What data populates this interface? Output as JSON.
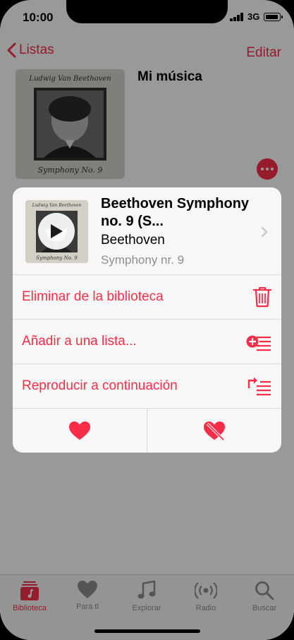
{
  "status": {
    "time": "10:00",
    "network": "3G"
  },
  "nav": {
    "back_label": "Listas",
    "edit_label": "Editar"
  },
  "background": {
    "playlist_title": "Mi música",
    "art_text_top": "Ludwig Van Beethoven",
    "art_text_bottom": "Symphony No. 9"
  },
  "sheet": {
    "song_title": "Beethoven Symphony no. 9 (S...",
    "artist": "Beethoven",
    "album": "Symphony nr. 9",
    "thumb_text_top": "Ludwig Van Beethoven",
    "thumb_text_bottom": "Symphony No. 9",
    "actions": [
      {
        "label": "Eliminar de la biblioteca",
        "icon": "trash-icon"
      },
      {
        "label": "Añadir a una lista...",
        "icon": "add-to-playlist-icon"
      },
      {
        "label": "Reproducir a continuación",
        "icon": "play-next-icon"
      }
    ],
    "bottom": {
      "left_icon": "heart-icon",
      "right_icon": "dislike-heart-icon"
    }
  },
  "tabs": [
    {
      "label": "Biblioteca",
      "icon": "library-icon",
      "active": true
    },
    {
      "label": "Para ti",
      "icon": "heart-icon",
      "active": false
    },
    {
      "label": "Explorar",
      "icon": "music-note-icon",
      "active": false
    },
    {
      "label": "Radio",
      "icon": "radio-icon",
      "active": false
    },
    {
      "label": "Buscar",
      "icon": "search-icon",
      "active": false
    }
  ],
  "colors": {
    "accent": "#fa2d48",
    "secondary": "#8e8e93"
  }
}
